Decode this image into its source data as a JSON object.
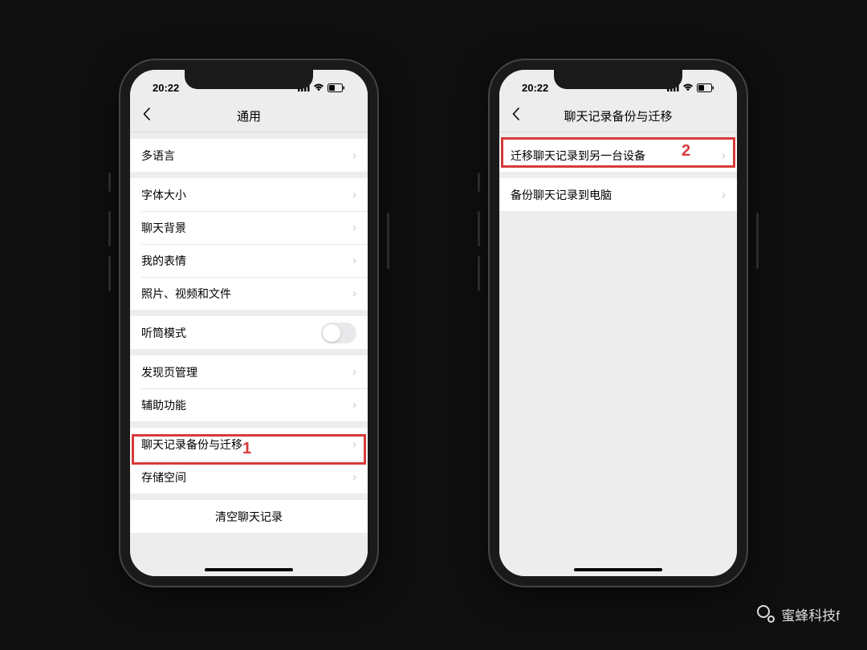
{
  "status": {
    "time": "20:22"
  },
  "phone1": {
    "navTitle": "通用",
    "items": {
      "multiLanguage": "多语言",
      "fontSize": "字体大小",
      "chatBackground": "聊天背景",
      "myStickers": "我的表情",
      "photosVideosFiles": "照片、视频和文件",
      "earpieceMode": "听筒模式",
      "discoverPage": "发现页管理",
      "accessibility": "辅助功能",
      "chatBackupMigrate": "聊天记录备份与迁移",
      "storage": "存储空间",
      "clearChatHistory": "清空聊天记录"
    },
    "highlightLabel": "1"
  },
  "phone2": {
    "navTitle": "聊天记录备份与迁移",
    "items": {
      "migrateToDevice": "迁移聊天记录到另一台设备",
      "backupToComputer": "备份聊天记录到电脑"
    },
    "highlightLabel": "2"
  },
  "watermark": "蜜蜂科技f"
}
